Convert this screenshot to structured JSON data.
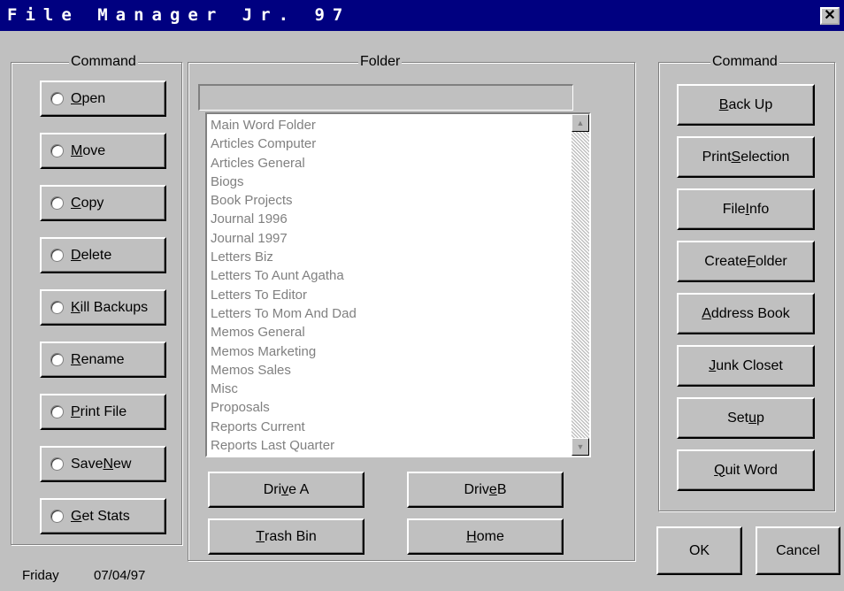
{
  "window": {
    "title": "File Manager Jr. 97",
    "close_symbol": "✕"
  },
  "left_group": {
    "legend": "Command",
    "items": [
      {
        "pre": "",
        "u": "O",
        "post": "pen"
      },
      {
        "pre": "",
        "u": "M",
        "post": "ove"
      },
      {
        "pre": "",
        "u": "C",
        "post": "opy"
      },
      {
        "pre": "",
        "u": "D",
        "post": "elete"
      },
      {
        "pre": "",
        "u": "K",
        "post": "ill Backups"
      },
      {
        "pre": "",
        "u": "R",
        "post": "ename"
      },
      {
        "pre": "",
        "u": "P",
        "post": "rint File"
      },
      {
        "pre": "Save ",
        "u": "N",
        "post": "ew"
      },
      {
        "pre": "",
        "u": "G",
        "post": "et Stats"
      }
    ]
  },
  "folder_group": {
    "legend": "Folder",
    "path_value": "",
    "items": [
      "Main Word Folder",
      "Articles Computer",
      "Articles General",
      "Biogs",
      "Book Projects",
      "Journal 1996",
      "Journal 1997",
      "Letters Biz",
      "Letters To Aunt Agatha",
      "Letters To Editor",
      "Letters To Mom And Dad",
      "Memos General",
      "Memos Marketing",
      "Memos Sales",
      "Misc",
      "Proposals",
      "Reports Current",
      "Reports Last Quarter"
    ],
    "scroll_up": "▲",
    "scroll_down": "▼",
    "buttons": {
      "drive_a": {
        "pre": "Dri",
        "u": "v",
        "post": "e A"
      },
      "drive_b": {
        "pre": "Driv",
        "u": "e",
        "post": " B"
      },
      "trash": {
        "pre": "",
        "u": "T",
        "post": "rash Bin"
      },
      "home": {
        "pre": "",
        "u": "H",
        "post": "ome"
      }
    }
  },
  "right_group": {
    "legend": "Command",
    "items": [
      {
        "pre": "",
        "u": "B",
        "post": "ack Up"
      },
      {
        "pre": "Print ",
        "u": "S",
        "post": "election"
      },
      {
        "pre": "File ",
        "u": "I",
        "post": "nfo"
      },
      {
        "pre": "Create ",
        "u": "F",
        "post": "older"
      },
      {
        "pre": "",
        "u": "A",
        "post": "ddress Book"
      },
      {
        "pre": "",
        "u": "J",
        "post": "unk Closet"
      },
      {
        "pre": "Set",
        "u": "u",
        "post": "p"
      },
      {
        "pre": "",
        "u": "Q",
        "post": "uit Word"
      }
    ]
  },
  "dialog_buttons": {
    "ok": "OK",
    "cancel": "Cancel"
  },
  "status": {
    "day": "Friday",
    "date": "07/04/97"
  }
}
